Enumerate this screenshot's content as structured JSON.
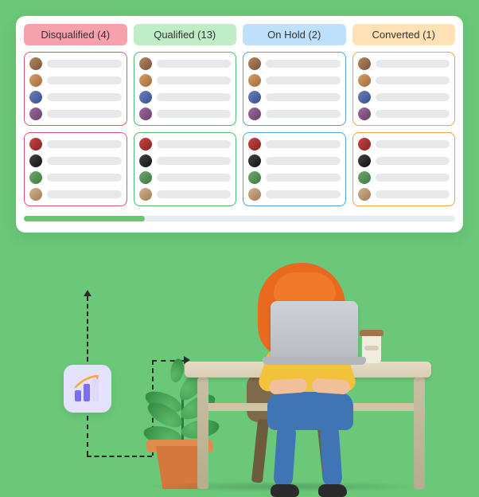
{
  "columns": [
    {
      "label": "Disqualified (4)",
      "tab_bg": "#f6a1ac",
      "border": "#e45569"
    },
    {
      "label": "Qualified (13)",
      "tab_bg": "#bfeec6",
      "border": "#4eb96a"
    },
    {
      "label": "On Hold (2)",
      "tab_bg": "#bfe0fb",
      "border": "#4a9fe3"
    },
    {
      "label": "Converted (1)",
      "tab_bg": "#ffe1b5",
      "border": "#f0a23c"
    }
  ],
  "card_entries_per_card": 4,
  "cards_per_column": 2,
  "avatar_palette": [
    "linear-gradient(135deg,#b58863,#7a5337)",
    "linear-gradient(135deg,#d9a066,#a06a3a)",
    "linear-gradient(135deg,#6b7fbf,#3b4f8f)",
    "linear-gradient(135deg,#9d6b9e,#6a3f6b)",
    "linear-gradient(135deg,#c44,#822)",
    "linear-gradient(135deg,#444,#111)",
    "linear-gradient(135deg,#6fa86f,#3f7a3f)",
    "linear-gradient(135deg,#d4b08c,#a07c58)"
  ],
  "scroll_progress_pct": 28,
  "chart_tile_icon": "bar-chart-trend"
}
